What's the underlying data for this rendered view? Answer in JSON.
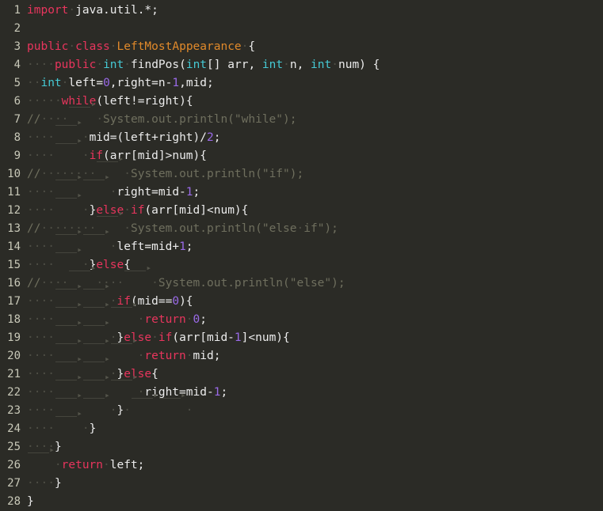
{
  "editor": {
    "language": "java",
    "file_name": "LeftMostAppearance.java",
    "total_lines": 28,
    "theme": {
      "background": "#2b2b26",
      "gutter_text": "#c8c8b8",
      "default_text": "#ececec",
      "keyword": "#e8355d",
      "type": "#45c9d4",
      "class_name": "#e0892a",
      "number": "#9a6ae8",
      "comment": "#6f6f5e",
      "whitespace_marker": "#4e4e45"
    },
    "lines": [
      {
        "num": "1",
        "text": "import java.util.*;"
      },
      {
        "num": "2",
        "text": ""
      },
      {
        "num": "3",
        "text": "public class LeftMostAppearance {"
      },
      {
        "num": "4",
        "text": "    public int findPos(int[] arr, int n, int num) {"
      },
      {
        "num": "5",
        "text": "  int left=0,right=n-1,mid;"
      },
      {
        "num": "6",
        "text": "     while(left!=right){"
      },
      {
        "num": "7",
        "text": "//    \tSystem.out.println(\"while\");"
      },
      {
        "num": "8",
        "text": "    \t mid=(left+right)/2;"
      },
      {
        "num": "9",
        "text": "    \t if(arr[mid]>num){"
      },
      {
        "num": "10",
        "text": "//        \tSystem.out.println(\"if\");"
      },
      {
        "num": "11",
        "text": "    \t\t right=mid-1;"
      },
      {
        "num": "12",
        "text": "    \t }else if(arr[mid]<num){"
      },
      {
        "num": "13",
        "text": "//        \tSystem.out.println(\"else if\");"
      },
      {
        "num": "14",
        "text": "    \t\t left=mid+1;"
      },
      {
        "num": "15",
        "text": "    \t }else{"
      },
      {
        "num": "16",
        "text": "//    \t    \tSystem.out.println(\"else\");"
      },
      {
        "num": "17",
        "text": "    \t\t if(mid==0){"
      },
      {
        "num": "18",
        "text": "    \t\t\t return 0;"
      },
      {
        "num": "19",
        "text": "    \t\t }else if(arr[mid-1]<num){"
      },
      {
        "num": "20",
        "text": "    \t\t\t return mid;"
      },
      {
        "num": "21",
        "text": "    \t\t }else{"
      },
      {
        "num": "22",
        "text": "    \t\t\t right=mid-1;"
      },
      {
        "num": "23",
        "text": "    \t\t } \t\t "
      },
      {
        "num": "24",
        "text": "    \t }"
      },
      {
        "num": "25",
        "text": "    }"
      },
      {
        "num": "26",
        "text": "\t return left;"
      },
      {
        "num": "27",
        "text": "    }"
      },
      {
        "num": "28",
        "text": "}"
      }
    ],
    "tokens": [
      [
        {
          "t": "import",
          "c": "kw"
        },
        {
          "t": " ",
          "c": "sp"
        },
        {
          "t": "java.util.*;",
          "c": "plain"
        }
      ],
      [],
      [
        {
          "t": "public",
          "c": "kw"
        },
        {
          "t": " ",
          "c": "sp"
        },
        {
          "t": "class",
          "c": "kw"
        },
        {
          "t": " ",
          "c": "sp"
        },
        {
          "t": "LeftMostAppearance",
          "c": "cls"
        },
        {
          "t": " ",
          "c": "sp"
        },
        {
          "t": "{",
          "c": "plain"
        }
      ],
      [
        {
          "t": "    ",
          "c": "sp"
        },
        {
          "t": "public",
          "c": "kw"
        },
        {
          "t": " ",
          "c": "sp"
        },
        {
          "t": "int",
          "c": "type"
        },
        {
          "t": " ",
          "c": "sp"
        },
        {
          "t": "findPos(",
          "c": "plain"
        },
        {
          "t": "int",
          "c": "type"
        },
        {
          "t": "[] ",
          "c": "plain"
        },
        {
          "t": "arr, ",
          "c": "plain"
        },
        {
          "t": "int",
          "c": "type"
        },
        {
          "t": " ",
          "c": "sp"
        },
        {
          "t": "n, ",
          "c": "plain"
        },
        {
          "t": "int",
          "c": "type"
        },
        {
          "t": " ",
          "c": "sp"
        },
        {
          "t": "num) ",
          "c": "plain"
        },
        {
          "t": "{",
          "c": "plain"
        }
      ],
      [
        {
          "t": "  ",
          "c": "sp"
        },
        {
          "t": "int",
          "c": "type"
        },
        {
          "t": " ",
          "c": "sp"
        },
        {
          "t": "left=",
          "c": "plain"
        },
        {
          "t": "0",
          "c": "num"
        },
        {
          "t": ",right=n-",
          "c": "plain"
        },
        {
          "t": "1",
          "c": "num"
        },
        {
          "t": ",mid;",
          "c": "plain"
        }
      ],
      [
        {
          "t": "     ",
          "c": "sp"
        },
        {
          "t": "while",
          "c": "kw"
        },
        {
          "t": "(left!=right){",
          "c": "plain"
        }
      ],
      [
        {
          "t": "//",
          "c": "cmt"
        },
        {
          "t": "    ",
          "c": "cws"
        },
        {
          "t": "TAB",
          "c": "tab"
        },
        {
          "t": " ",
          "c": "cws"
        },
        {
          "t": "System.out.println(\"while\");",
          "c": "cmt"
        }
      ],
      [
        {
          "t": "    ",
          "c": "sp"
        },
        {
          "t": "TAB",
          "c": "tab"
        },
        {
          "t": " ",
          "c": "sp"
        },
        {
          "t": "mid=(left+right)/",
          "c": "plain"
        },
        {
          "t": "2",
          "c": "num"
        },
        {
          "t": ";",
          "c": "plain"
        }
      ],
      [
        {
          "t": "    ",
          "c": "sp"
        },
        {
          "t": "TAB",
          "c": "tab"
        },
        {
          "t": " ",
          "c": "sp"
        },
        {
          "t": "if",
          "c": "kw"
        },
        {
          "t": "(arr[mid]>num){",
          "c": "plain"
        }
      ],
      [
        {
          "t": "//",
          "c": "cmt"
        },
        {
          "t": "        ",
          "c": "cws"
        },
        {
          "t": "TAB",
          "c": "tab"
        },
        {
          "t": " ",
          "c": "cws"
        },
        {
          "t": "System.out.println(\"if\");",
          "c": "cmt"
        }
      ],
      [
        {
          "t": "    ",
          "c": "sp"
        },
        {
          "t": "TAB",
          "c": "tab"
        },
        {
          "t": "TAB",
          "c": "tab"
        },
        {
          "t": " ",
          "c": "sp"
        },
        {
          "t": "right=mid-",
          "c": "plain"
        },
        {
          "t": "1",
          "c": "num"
        },
        {
          "t": ";",
          "c": "plain"
        }
      ],
      [
        {
          "t": "    ",
          "c": "sp"
        },
        {
          "t": "TAB",
          "c": "tab"
        },
        {
          "t": " ",
          "c": "sp"
        },
        {
          "t": "}",
          "c": "plain"
        },
        {
          "t": "else",
          "c": "kw"
        },
        {
          "t": " ",
          "c": "sp"
        },
        {
          "t": "if",
          "c": "kw"
        },
        {
          "t": "(arr[mid]<num){",
          "c": "plain"
        }
      ],
      [
        {
          "t": "//",
          "c": "cmt"
        },
        {
          "t": "        ",
          "c": "cws"
        },
        {
          "t": "TAB",
          "c": "tab"
        },
        {
          "t": " ",
          "c": "cws"
        },
        {
          "t": "System.out.println(\"else",
          "c": "cmt"
        },
        {
          "t": " ",
          "c": "cws"
        },
        {
          "t": "if\");",
          "c": "cmt"
        }
      ],
      [
        {
          "t": "    ",
          "c": "sp"
        },
        {
          "t": "TAB",
          "c": "tab"
        },
        {
          "t": "TAB",
          "c": "tab"
        },
        {
          "t": " ",
          "c": "sp"
        },
        {
          "t": "left=mid+",
          "c": "plain"
        },
        {
          "t": "1",
          "c": "num"
        },
        {
          "t": ";",
          "c": "plain"
        }
      ],
      [
        {
          "t": "    ",
          "c": "sp"
        },
        {
          "t": "TAB",
          "c": "tab"
        },
        {
          "t": " ",
          "c": "sp"
        },
        {
          "t": "}",
          "c": "plain"
        },
        {
          "t": "else",
          "c": "kw"
        },
        {
          "t": "{",
          "c": "plain"
        }
      ],
      [
        {
          "t": "//",
          "c": "cmt"
        },
        {
          "t": "    ",
          "c": "cws"
        },
        {
          "t": "TAB",
          "c": "tab"
        },
        {
          "t": "    ",
          "c": "cws"
        },
        {
          "t": "TAB",
          "c": "tab"
        },
        {
          "t": " ",
          "c": "cws"
        },
        {
          "t": "System.out.println(\"else\");",
          "c": "cmt"
        }
      ],
      [
        {
          "t": "    ",
          "c": "sp"
        },
        {
          "t": "TAB",
          "c": "tab"
        },
        {
          "t": "TAB",
          "c": "tab"
        },
        {
          "t": " ",
          "c": "sp"
        },
        {
          "t": "if",
          "c": "kw"
        },
        {
          "t": "(mid==",
          "c": "plain"
        },
        {
          "t": "0",
          "c": "num"
        },
        {
          "t": "){",
          "c": "plain"
        }
      ],
      [
        {
          "t": "    ",
          "c": "sp"
        },
        {
          "t": "TAB",
          "c": "tab"
        },
        {
          "t": "TAB",
          "c": "tab"
        },
        {
          "t": "TAB",
          "c": "tab"
        },
        {
          "t": " ",
          "c": "sp"
        },
        {
          "t": "return",
          "c": "kw"
        },
        {
          "t": " ",
          "c": "sp"
        },
        {
          "t": "0",
          "c": "num"
        },
        {
          "t": ";",
          "c": "plain"
        }
      ],
      [
        {
          "t": "    ",
          "c": "sp"
        },
        {
          "t": "TAB",
          "c": "tab"
        },
        {
          "t": "TAB",
          "c": "tab"
        },
        {
          "t": " ",
          "c": "sp"
        },
        {
          "t": "}",
          "c": "plain"
        },
        {
          "t": "else",
          "c": "kw"
        },
        {
          "t": " ",
          "c": "sp"
        },
        {
          "t": "if",
          "c": "kw"
        },
        {
          "t": "(arr[mid-",
          "c": "plain"
        },
        {
          "t": "1",
          "c": "num"
        },
        {
          "t": "]<num){",
          "c": "plain"
        }
      ],
      [
        {
          "t": "    ",
          "c": "sp"
        },
        {
          "t": "TAB",
          "c": "tab"
        },
        {
          "t": "TAB",
          "c": "tab"
        },
        {
          "t": "TAB",
          "c": "tab"
        },
        {
          "t": " ",
          "c": "sp"
        },
        {
          "t": "return",
          "c": "kw"
        },
        {
          "t": " ",
          "c": "sp"
        },
        {
          "t": "mid;",
          "c": "plain"
        }
      ],
      [
        {
          "t": "    ",
          "c": "sp"
        },
        {
          "t": "TAB",
          "c": "tab"
        },
        {
          "t": "TAB",
          "c": "tab"
        },
        {
          "t": " ",
          "c": "sp"
        },
        {
          "t": "}",
          "c": "plain"
        },
        {
          "t": "else",
          "c": "kw"
        },
        {
          "t": "{",
          "c": "plain"
        }
      ],
      [
        {
          "t": "    ",
          "c": "sp"
        },
        {
          "t": "TAB",
          "c": "tab"
        },
        {
          "t": "TAB",
          "c": "tab"
        },
        {
          "t": "TAB",
          "c": "tab"
        },
        {
          "t": " ",
          "c": "sp"
        },
        {
          "t": "right=mid-",
          "c": "plain"
        },
        {
          "t": "1",
          "c": "num"
        },
        {
          "t": ";",
          "c": "plain"
        }
      ],
      [
        {
          "t": "    ",
          "c": "sp"
        },
        {
          "t": "TAB",
          "c": "tab"
        },
        {
          "t": "TAB",
          "c": "tab"
        },
        {
          "t": " ",
          "c": "sp"
        },
        {
          "t": "}",
          "c": "plain"
        },
        {
          "t": " ",
          "c": "sp"
        },
        {
          "t": "TAB",
          "c": "tab"
        },
        {
          "t": "TAB",
          "c": "tab"
        },
        {
          "t": " ",
          "c": "sp"
        }
      ],
      [
        {
          "t": "    ",
          "c": "sp"
        },
        {
          "t": "TAB",
          "c": "tab"
        },
        {
          "t": " ",
          "c": "sp"
        },
        {
          "t": "}",
          "c": "plain"
        }
      ],
      [
        {
          "t": "    ",
          "c": "sp"
        },
        {
          "t": "}",
          "c": "plain"
        }
      ],
      [
        {
          "t": "TAB",
          "c": "tab"
        },
        {
          "t": " ",
          "c": "sp"
        },
        {
          "t": "return",
          "c": "kw"
        },
        {
          "t": " ",
          "c": "sp"
        },
        {
          "t": "left;",
          "c": "plain"
        }
      ],
      [
        {
          "t": "    ",
          "c": "sp"
        },
        {
          "t": "}",
          "c": "plain"
        }
      ],
      [
        {
          "t": "}",
          "c": "plain"
        }
      ]
    ]
  }
}
